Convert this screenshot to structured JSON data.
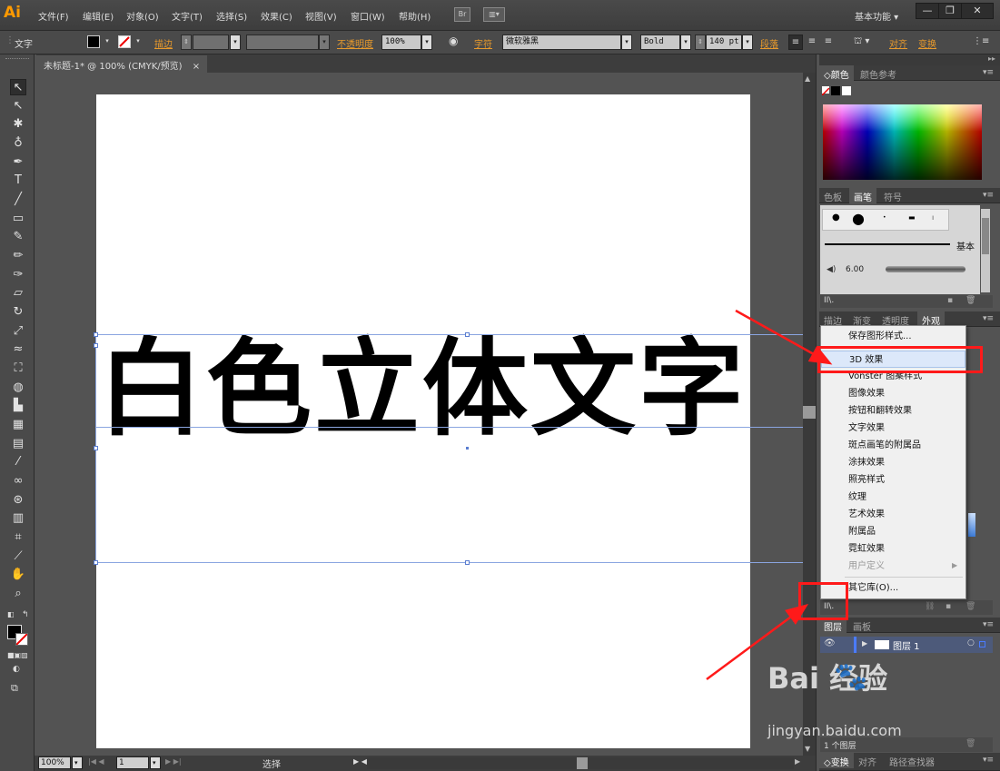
{
  "app": {
    "logo": "Ai"
  },
  "menubar": {
    "items": [
      "文件(F)",
      "编辑(E)",
      "对象(O)",
      "文字(T)",
      "选择(S)",
      "效果(C)",
      "视图(V)",
      "窗口(W)",
      "帮助(H)"
    ],
    "bridge_icon": "Br",
    "workspace": "基本功能 ▾"
  },
  "control": {
    "tool_label": "文字",
    "stroke_label": "描边",
    "opacity_label": "不透明度",
    "opacity_value": "100%",
    "char_label": "字符",
    "font_family": "微软雅黑",
    "font_style": "Bold",
    "font_size": "140 pt",
    "para_label": "段落",
    "align_label": "对齐",
    "transform_label": "变换"
  },
  "document": {
    "tab_title": "未标题-1* @ 100% (CMYK/预览)",
    "tab_close": "×"
  },
  "canvas": {
    "text": "白色立体文字"
  },
  "status": {
    "zoom": "100%",
    "page": "1",
    "mode": "选择"
  },
  "panels": {
    "color_tabs": [
      "颜色",
      "颜色参考"
    ],
    "brush_tabs": [
      "色板",
      "画笔",
      "符号"
    ],
    "brush_basic": "基本",
    "brush_size": "6.00",
    "appearance_tabs": [
      "描边",
      "渐变",
      "透明度",
      "外观"
    ],
    "layers_tabs": [
      "图层",
      "画板"
    ],
    "layer_name": "图层 1",
    "layers_count": "1 个图层",
    "bottom_tabs": [
      "变换",
      "对齐",
      "路径查找器"
    ]
  },
  "dropdown": {
    "items": [
      {
        "label": "保存图形样式...",
        "highlight": false,
        "disabled": false
      },
      {
        "label": "3D 效果",
        "highlight": true,
        "disabled": false
      },
      {
        "label": "Vonster 图案样式",
        "highlight": false,
        "disabled": false
      },
      {
        "label": "图像效果",
        "highlight": false,
        "disabled": false
      },
      {
        "label": "按钮和翻转效果",
        "highlight": false,
        "disabled": false
      },
      {
        "label": "文字效果",
        "highlight": false,
        "disabled": false
      },
      {
        "label": "斑点画笔的附属品",
        "highlight": false,
        "disabled": false
      },
      {
        "label": "涂抹效果",
        "highlight": false,
        "disabled": false
      },
      {
        "label": "照亮样式",
        "highlight": false,
        "disabled": false
      },
      {
        "label": "纹理",
        "highlight": false,
        "disabled": false
      },
      {
        "label": "艺术效果",
        "highlight": false,
        "disabled": false
      },
      {
        "label": "附属品",
        "highlight": false,
        "disabled": false
      },
      {
        "label": "霓虹效果",
        "highlight": false,
        "disabled": false
      },
      {
        "label": "用户定义",
        "highlight": false,
        "disabled": true
      },
      {
        "label": "其它库(O)...",
        "highlight": false,
        "disabled": false
      }
    ]
  },
  "watermark": {
    "brand": "Bai 经验",
    "url": "jingyan.baidu.com"
  },
  "colors": {
    "accent": "#e89a2c",
    "annotation": "#ff1a1a",
    "selection": "#8aa5e0"
  }
}
